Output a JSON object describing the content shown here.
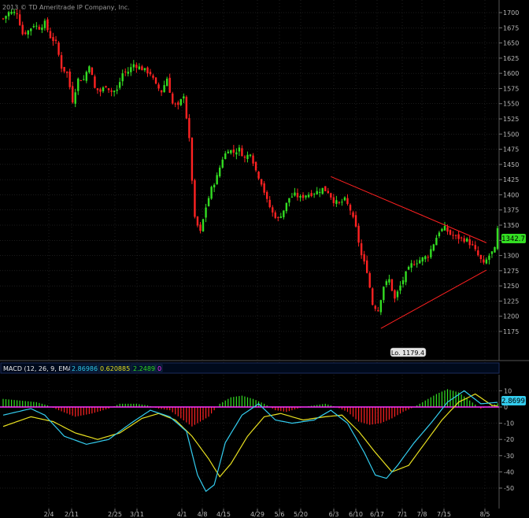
{
  "copyright": "2013 © TD Ameritrade IP Company, Inc.",
  "colors": {
    "background": "#000000",
    "up": "#33dd22",
    "down": "#ff2222",
    "grid": "#3a3a3a",
    "axis_text": "#b8b8b8",
    "trend": "#ff2020",
    "macd_line": "#33ccee",
    "signal_line": "#e8e020",
    "zero_line": "#ff33ff",
    "macd_header_bg": "#000a1c",
    "macd_header_border": "#1c2c5c"
  },
  "price": {
    "current_label": "1342.7",
    "low_label": "Lo. 1179.4",
    "y_ticks": [
      1700,
      1675,
      1650,
      1625,
      1600,
      1575,
      1550,
      1525,
      1500,
      1475,
      1450,
      1425,
      1400,
      1375,
      1350,
      1325,
      1300,
      1275,
      1250,
      1225,
      1200,
      1175
    ]
  },
  "macd": {
    "label": "MACD (12, 26, 9, EMA)",
    "macd_value": "2.86986",
    "signal_value": "0.620885",
    "diff_value": "2.24897",
    "extra_value": "0",
    "current_label": "2.8699",
    "y_ticks": [
      10,
      0,
      -10,
      -20,
      -30,
      -40,
      -50
    ]
  },
  "x_axis": {
    "labels": [
      "2/4",
      "2/11",
      "2/25",
      "3/11",
      "4/1",
      "4/8",
      "4/15",
      "4/29",
      "5/6",
      "5/20",
      "6/3",
      "6/10",
      "6/17",
      "7/1",
      "7/8",
      "7/15",
      "8/5"
    ]
  },
  "chart_data": [
    {
      "type": "candlestick",
      "title": "",
      "ylim": [
        1170,
        1710
      ],
      "y_ticks": [
        1700,
        1675,
        1650,
        1625,
        1600,
        1575,
        1550,
        1525,
        1500,
        1475,
        1450,
        1425,
        1400,
        1375,
        1350,
        1325,
        1300,
        1275,
        1250,
        1225,
        1200,
        1175
      ],
      "x_tick_labels": [
        "2/4",
        "2/11",
        "2/25",
        "3/11",
        "4/1",
        "4/8",
        "4/15",
        "4/29",
        "5/6",
        "5/20",
        "6/3",
        "6/10",
        "6/17",
        "7/1",
        "7/8",
        "7/15",
        "8/5"
      ],
      "close_path": [
        [
          0,
          1690
        ],
        [
          2,
          1700
        ],
        [
          5,
          1700
        ],
        [
          7,
          1665
        ],
        [
          9,
          1670
        ],
        [
          11,
          1680
        ],
        [
          13,
          1675
        ],
        [
          15,
          1683
        ],
        [
          17,
          1660
        ],
        [
          19,
          1650
        ],
        [
          21,
          1610
        ],
        [
          23,
          1600
        ],
        [
          25,
          1555
        ],
        [
          27,
          1590
        ],
        [
          29,
          1590
        ],
        [
          31,
          1615
        ],
        [
          33,
          1575
        ],
        [
          35,
          1570
        ],
        [
          37,
          1580
        ],
        [
          39,
          1570
        ],
        [
          41,
          1572
        ],
        [
          43,
          1600
        ],
        [
          45,
          1603
        ],
        [
          47,
          1615
        ],
        [
          49,
          1610
        ],
        [
          51,
          1605
        ],
        [
          53,
          1600
        ],
        [
          55,
          1580
        ],
        [
          57,
          1570
        ],
        [
          59,
          1592
        ],
        [
          61,
          1550
        ],
        [
          63,
          1545
        ],
        [
          65,
          1565
        ],
        [
          67,
          1490
        ],
        [
          69,
          1360
        ],
        [
          71,
          1338
        ],
        [
          73,
          1380
        ],
        [
          75,
          1410
        ],
        [
          77,
          1430
        ],
        [
          79,
          1460
        ],
        [
          81,
          1475
        ],
        [
          83,
          1470
        ],
        [
          85,
          1475
        ],
        [
          87,
          1460
        ],
        [
          89,
          1470
        ],
        [
          91,
          1440
        ],
        [
          93,
          1420
        ],
        [
          95,
          1390
        ],
        [
          97,
          1370
        ],
        [
          99,
          1360
        ],
        [
          101,
          1375
        ],
        [
          103,
          1395
        ],
        [
          105,
          1400
        ],
        [
          107,
          1395
        ],
        [
          109,
          1400
        ],
        [
          111,
          1402
        ],
        [
          113,
          1405
        ],
        [
          115,
          1410
        ],
        [
          117,
          1405
        ],
        [
          119,
          1390
        ],
        [
          121,
          1385
        ],
        [
          123,
          1392
        ],
        [
          125,
          1375
        ],
        [
          127,
          1345
        ],
        [
          129,
          1300
        ],
        [
          131,
          1275
        ],
        [
          133,
          1220
        ],
        [
          135,
          1210
        ],
        [
          137,
          1250
        ],
        [
          139,
          1260
        ],
        [
          141,
          1228
        ],
        [
          143,
          1250
        ],
        [
          145,
          1270
        ],
        [
          147,
          1285
        ],
        [
          149,
          1290
        ],
        [
          151,
          1295
        ],
        [
          153,
          1300
        ],
        [
          155,
          1320
        ],
        [
          157,
          1340
        ],
        [
          159,
          1345
        ],
        [
          161,
          1335
        ],
        [
          163,
          1330
        ],
        [
          165,
          1328
        ],
        [
          167,
          1325
        ],
        [
          169,
          1315
        ],
        [
          171,
          1300
        ],
        [
          173,
          1285
        ],
        [
          175,
          1300
        ],
        [
          177,
          1310
        ],
        [
          178,
          1342.7
        ]
      ],
      "overlays": [
        {
          "type": "trendline",
          "from": [
            118,
            1430
          ],
          "to": [
            174,
            1321
          ]
        },
        {
          "type": "trendline",
          "from": [
            136,
            1180
          ],
          "to": [
            174,
            1276
          ]
        }
      ],
      "annotations": [
        "Lo. 1179.4",
        "1342.7"
      ]
    },
    {
      "type": "bar+line",
      "title": "MACD (12, 26, 9, EMA)",
      "ylim": [
        -58,
        15
      ],
      "y_ticks": [
        10,
        0,
        -10,
        -20,
        -30,
        -40,
        -50
      ],
      "series": [
        {
          "name": "MACD",
          "values_path": [
            [
              0,
              -5
            ],
            [
              10,
              -1
            ],
            [
              15,
              -5
            ],
            [
              22,
              -18
            ],
            [
              30,
              -23
            ],
            [
              38,
              -20
            ],
            [
              46,
              -10
            ],
            [
              53,
              -2
            ],
            [
              60,
              -6
            ],
            [
              66,
              -15
            ],
            [
              70,
              -42
            ],
            [
              73,
              -52
            ],
            [
              76,
              -48
            ],
            [
              80,
              -22
            ],
            [
              86,
              -5
            ],
            [
              92,
              2
            ],
            [
              98,
              -8
            ],
            [
              104,
              -10
            ],
            [
              112,
              -8
            ],
            [
              118,
              -2
            ],
            [
              124,
              -10
            ],
            [
              130,
              -28
            ],
            [
              134,
              -42
            ],
            [
              138,
              -44
            ],
            [
              142,
              -36
            ],
            [
              148,
              -22
            ],
            [
              154,
              -10
            ],
            [
              160,
              3
            ],
            [
              166,
              10
            ],
            [
              172,
              2
            ],
            [
              178,
              2.87
            ]
          ]
        },
        {
          "name": "Signal",
          "values_path": [
            [
              0,
              -12
            ],
            [
              10,
              -6
            ],
            [
              18,
              -9
            ],
            [
              26,
              -16
            ],
            [
              34,
              -20
            ],
            [
              42,
              -16
            ],
            [
              50,
              -7
            ],
            [
              56,
              -4
            ],
            [
              62,
              -8
            ],
            [
              68,
              -18
            ],
            [
              74,
              -32
            ],
            [
              78,
              -43
            ],
            [
              82,
              -35
            ],
            [
              88,
              -18
            ],
            [
              94,
              -6
            ],
            [
              100,
              -4
            ],
            [
              108,
              -8
            ],
            [
              116,
              -6
            ],
            [
              122,
              -5
            ],
            [
              128,
              -15
            ],
            [
              134,
              -28
            ],
            [
              140,
              -40
            ],
            [
              146,
              -36
            ],
            [
              152,
              -22
            ],
            [
              158,
              -8
            ],
            [
              164,
              3
            ],
            [
              170,
              8
            ],
            [
              176,
              1
            ],
            [
              178,
              0.62
            ]
          ]
        },
        {
          "name": "Histogram",
          "values_path": [
            [
              0,
              5
            ],
            [
              6,
              4
            ],
            [
              12,
              3
            ],
            [
              16,
              1
            ],
            [
              20,
              -2
            ],
            [
              26,
              -6
            ],
            [
              32,
              -4
            ],
            [
              38,
              -1
            ],
            [
              42,
              2
            ],
            [
              48,
              2
            ],
            [
              52,
              1
            ],
            [
              56,
              -1
            ],
            [
              60,
              -2
            ],
            [
              64,
              -7
            ],
            [
              68,
              -12
            ],
            [
              70,
              -10
            ],
            [
              74,
              -6
            ],
            [
              78,
              2
            ],
            [
              82,
              6
            ],
            [
              86,
              7
            ],
            [
              90,
              5
            ],
            [
              94,
              2
            ],
            [
              98,
              -2
            ],
            [
              102,
              -3
            ],
            [
              108,
              0
            ],
            [
              112,
              1
            ],
            [
              116,
              2
            ],
            [
              120,
              0
            ],
            [
              124,
              -3
            ],
            [
              128,
              -9
            ],
            [
              132,
              -11
            ],
            [
              136,
              -10
            ],
            [
              140,
              -7
            ],
            [
              144,
              -3
            ],
            [
              148,
              0
            ],
            [
              152,
              4
            ],
            [
              156,
              8
            ],
            [
              160,
              11
            ],
            [
              164,
              9
            ],
            [
              168,
              4
            ],
            [
              172,
              -1
            ],
            [
              176,
              1
            ],
            [
              178,
              2.25
            ]
          ]
        }
      ]
    }
  ]
}
